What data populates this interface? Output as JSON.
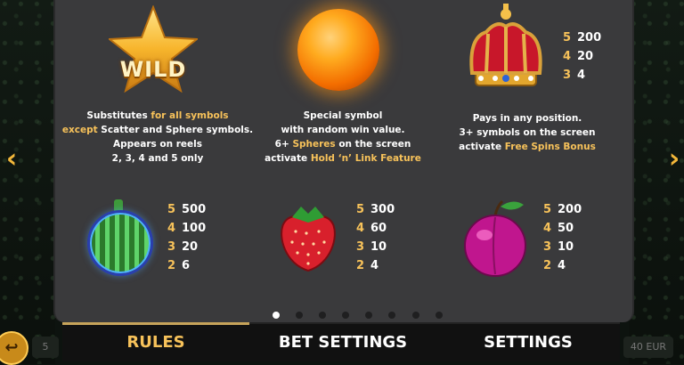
{
  "symbols": {
    "wild": {
      "label": "WILD",
      "desc_l1a": "Substitutes ",
      "desc_l1b": "for all symbols",
      "desc_l2a": "except ",
      "desc_l2b": "Scatter and Sphere symbols.",
      "desc_l3": "Appears on reels",
      "desc_l4": "2, 3, 4 and 5 only"
    },
    "sphere": {
      "desc_l1": "Special symbol",
      "desc_l2": "with random win value.",
      "desc_l3a": "6+ ",
      "desc_l3b": "Spheres",
      "desc_l3c": " on the screen",
      "desc_l4a": "activate ",
      "desc_l4b": "Hold ‘n’ Link Feature"
    },
    "crown": {
      "desc_l1": "Pays in any position.",
      "desc_l2": "3+ symbols on the screen",
      "desc_l3a": "activate ",
      "desc_l3b": "Free Spins Bonus",
      "pays": [
        {
          "count": "5",
          "amount": "200"
        },
        {
          "count": "4",
          "amount": "20"
        },
        {
          "count": "3",
          "amount": "4"
        }
      ]
    },
    "watermelon": {
      "pays": [
        {
          "count": "5",
          "amount": "500"
        },
        {
          "count": "4",
          "amount": "100"
        },
        {
          "count": "3",
          "amount": "20"
        },
        {
          "count": "2",
          "amount": "6"
        }
      ]
    },
    "strawberry": {
      "pays": [
        {
          "count": "5",
          "amount": "300"
        },
        {
          "count": "4",
          "amount": "60"
        },
        {
          "count": "3",
          "amount": "10"
        },
        {
          "count": "2",
          "amount": "4"
        }
      ]
    },
    "plum": {
      "pays": [
        {
          "count": "5",
          "amount": "200"
        },
        {
          "count": "4",
          "amount": "50"
        },
        {
          "count": "3",
          "amount": "10"
        },
        {
          "count": "2",
          "amount": "4"
        }
      ]
    }
  },
  "pagination": {
    "total": 8,
    "active_index": 0
  },
  "nav": {
    "prev": "‹",
    "next": "›"
  },
  "tabs": {
    "rules": "RULES",
    "bet_settings": "BET SETTINGS",
    "settings": "SETTINGS"
  },
  "hud": {
    "left_value": "5",
    "right_value": "40 EUR"
  },
  "colors": {
    "highlight": "#f7c25a",
    "panel": "#3a3a3c",
    "accent": "#f3b73a"
  }
}
